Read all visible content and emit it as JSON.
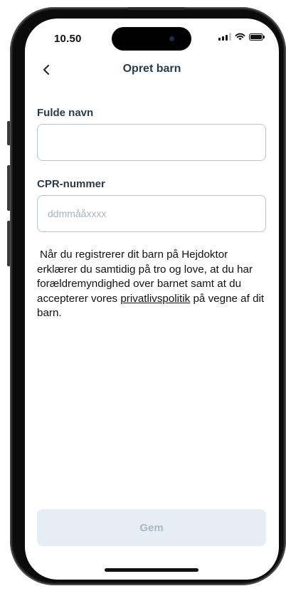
{
  "status_bar": {
    "time": "10.50",
    "icons": [
      "cellular-signal-icon",
      "wifi-icon",
      "battery-icon"
    ]
  },
  "nav": {
    "back_icon": "chevron-left-icon",
    "title": "Opret barn"
  },
  "form": {
    "full_name": {
      "label": "Fulde navn",
      "value": "",
      "placeholder": ""
    },
    "cpr": {
      "label": "CPR-nummer",
      "value": "",
      "placeholder": "ddmmååxxxx"
    }
  },
  "consent": {
    "text_before": "Når du registrerer dit barn på Hejdoktor erklærer du samtidig på tro og love, at du har forældremyndighed over barnet samt at du accepterer vores ",
    "link_text": "privatlivspolitik",
    "text_after": " på vegne af dit barn."
  },
  "actions": {
    "save_label": "Gem"
  },
  "colors": {
    "heading": "#2b3a4a",
    "input_border": "#b9c4cf",
    "placeholder": "#a9b3bd",
    "button_disabled_bg": "#e6edf4",
    "button_disabled_text": "#a9b8c6"
  }
}
